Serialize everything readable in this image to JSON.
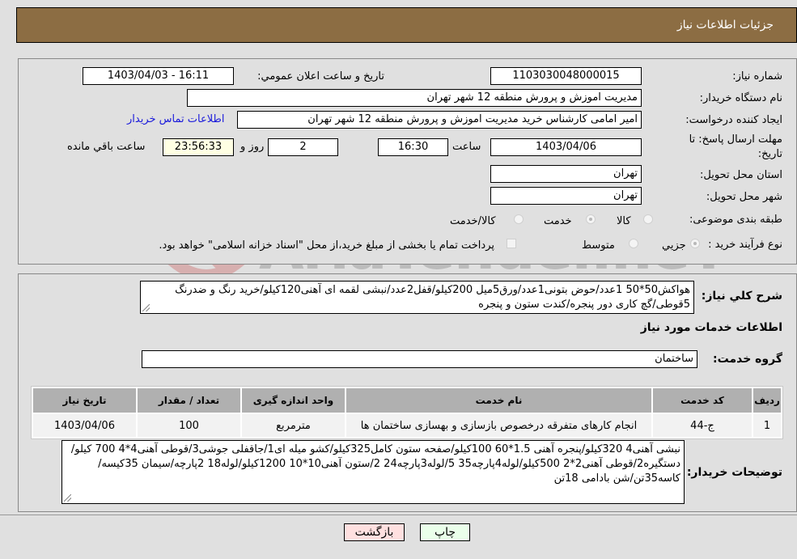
{
  "header": {
    "title": "جزئیات اطلاعات نیاز"
  },
  "details": {
    "need_number": {
      "label": "شماره نیاز:",
      "value": "1103030048000015"
    },
    "announce_datetime": {
      "label": "تاریخ و ساعت اعلان عمومي:",
      "value": "1403/04/03 - 16:11"
    },
    "buyer_org": {
      "label": "نام دستگاه خريدار:",
      "value": "مدیریت اموزش و پرورش منطقه 12 شهر تهران"
    },
    "requester": {
      "label": "ايجاد كننده درخواست:",
      "value": "امیر امامی کارشناس خرید مدیریت اموزش و پرورش منطقه 12 شهر تهران"
    },
    "buyer_contact_link": "اطلاعات تماس خریدار",
    "deadline": {
      "label_line1": "مهلت ارسال پاسخ: تا",
      "label_line2": "تاريخ:",
      "date": "1403/04/06",
      "time_label": "ساعت",
      "time": "16:30",
      "days": "2",
      "days_label": "روز و",
      "remaining": "23:56:33",
      "remaining_label": "ساعت باقي مانده"
    },
    "delivery_province": {
      "label": "استان محل تحويل:",
      "value": "تهران"
    },
    "delivery_city": {
      "label": "شهر محل تحويل:",
      "value": "تهران"
    },
    "category": {
      "label": "طبقه بندی موضوعی:",
      "options": [
        "کالا",
        "خدمت",
        "کالا/خدمت"
      ],
      "selected": "خدمت"
    },
    "purchase_type": {
      "label": "نوع فرآيند خريد :",
      "options": [
        "جزيي",
        "متوسط"
      ],
      "selected": "جزيي",
      "treasury_note": "پرداخت تمام یا بخشی از مبلغ خرید،از محل \"اسناد خزانه اسلامی\" خواهد بود."
    }
  },
  "description": {
    "label": "شرح كلي نياز:",
    "value": "هواکش50*50 1عدد/حوض بتونی1عدد/ورق5میل 200کیلو/قفل2عدد/نبشی لقمه ای آهنی120کیلو/خرید رنگ و ضدرنگ 5قوطی/گچ کاری دور پنجره/کندت ستون و پنجره"
  },
  "services": {
    "section_title": "اطلاعات خدمات مورد نياز",
    "group_label": "گروه خدمت:",
    "group_value": "ساختمان",
    "columns": [
      "رديف",
      "كد خدمت",
      "نام خدمت",
      "واحد اندازه گيری",
      "تعداد / مقدار",
      "تاريخ نياز"
    ],
    "rows": [
      [
        "1",
        "ج-44",
        "انجام کارهای متفرقه درخصوص بازسازی و بهسازی ساختمان ها",
        "مترمربع",
        "100",
        "1403/04/06"
      ]
    ]
  },
  "buyer_notes": {
    "label": "توضيحات خريدار:",
    "value": "نبشی آهنی4 320کیلو/پنجره آهنی 1.5*60 100کیلو/صفحه ستون کامل325کیلو/کشو میله ای1/جاقفلی جوشی3/قوطی آهنی4*4 700 کیلو/دستگیره2/قوطی آهنی2*2 500کیلو/لوله4پارچه35 5/لوله3پارچه24 2/ستون آهنی10*10 1200کیلو/لوله18 2پارچه/سیمان 35کیسه/کاسه35تن/شن بادامی 18تن"
  },
  "buttons": {
    "print": "چاپ",
    "back": "بازگشت"
  },
  "watermark": {
    "text": "AriaTender.neT"
  },
  "colors": {
    "header_bg": "#8c6d43",
    "remaining_bg": "#ffffe3",
    "print_bg": "#eaffea",
    "back_bg": "#ffe0e0",
    "link": "#1a1adb"
  }
}
